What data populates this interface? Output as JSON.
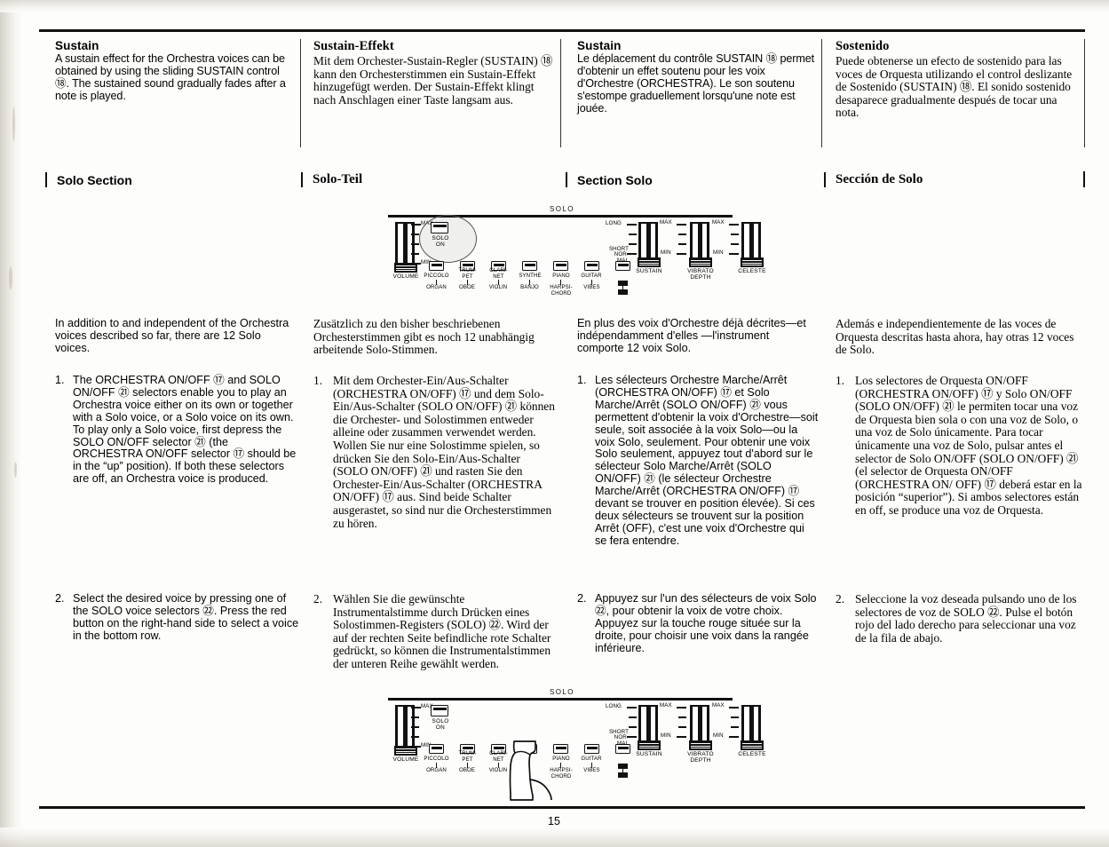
{
  "page": {
    "number": "15"
  },
  "sections": {
    "sustain": [
      {
        "lang": "en",
        "title": "Sustain",
        "body": "A sustain effect for the Orchestra voices can be obtained by using the sliding SUSTAIN control ⑱. The sustained sound gradually fades after a note is played."
      },
      {
        "lang": "de",
        "title": "Sustain-Effekt",
        "body": "Mit dem Orchester-Sustain-Regler (SUSTAIN) ⑱ kann den Orchesterstimmen ein Sustain-Effekt hinzugefügt werden. Der Sustain-Effekt klingt nach Anschlagen einer Taste langsam aus."
      },
      {
        "lang": "fr",
        "title": "Sustain",
        "body": "Le déplacement du contrôle SUSTAIN ⑱ permet d'obtenir un effet soutenu pour les voix d'Orchestre (ORCHESTRA). Le son soutenu s'estompe graduellement lorsqu'une note est jouée."
      },
      {
        "lang": "es",
        "title": "Sostenido",
        "body": "Puede obtenerse un efecto de sostenido para las voces de Orquesta utilizando el control deslizante de Sostenido (SUSTAIN) ⑱. El sonido sostenido desaparece gradualmente después de tocar una nota."
      }
    ],
    "solo_headers": [
      {
        "lang": "en",
        "label": "Solo Section"
      },
      {
        "lang": "de",
        "label": "Solo-Teil"
      },
      {
        "lang": "fr",
        "label": "Section Solo"
      },
      {
        "lang": "es",
        "label": "Sección de Solo"
      }
    ],
    "solo_intro": [
      {
        "lang": "en",
        "text": "In addition to and independent of the Orchestra voices described so far, there are 12 Solo voices."
      },
      {
        "lang": "de",
        "text": "Zusätzlich zu den bisher beschriebenen Orchesterstimmen gibt es noch 12 unabhängig arbeitende Solo-Stimmen."
      },
      {
        "lang": "fr",
        "text": "En plus des voix d'Orchestre déjà décrites—et indépendamment d'elles —l'instrument comporte 12 voix Solo."
      },
      {
        "lang": "es",
        "text": "Además e independientemente de las voces de Orquesta descritas hasta ahora, hay otras 12 voces de Solo."
      }
    ],
    "solo_items": [
      {
        "lang": "en",
        "items": [
          {
            "num": "1.",
            "text": "The ORCHESTRA ON/OFF ⑰ and SOLO ON/OFF ㉑ selectors enable you to play an Orchestra voice either on its own or together with a Solo voice, or a Solo voice on its own. To play only a Solo voice, first depress the SOLO ON/OFF selector ㉑ (the ORCHESTRA ON/OFF selector ⑰ should be in the “up” position). If both these selectors are off, an Orchestra voice is produced."
          },
          {
            "num": "2.",
            "text": "Select the desired voice by pressing one of the SOLO voice selectors ㉒. Press the red button on the right-hand side to select a voice in the bottom row."
          }
        ]
      },
      {
        "lang": "de",
        "items": [
          {
            "num": "1.",
            "text": "Mit dem Orchester-Ein/Aus-Schalter (ORCHESTRA ON/OFF) ⑰ und dem Solo-Ein/Aus-Schalter (SOLO ON/OFF) ㉑ können die Orchester- und Solostimmen entweder alleine oder zusammen verwendet werden. Wollen Sie nur eine Solostimme spielen, so drücken Sie den Solo-Ein/Aus-Schalter (SOLO ON/OFF) ㉑ und rasten Sie den Orchester-Ein/Aus-Schalter (ORCHESTRA ON/OFF) ⑰ aus. Sind beide Schalter ausgerastet, so sind nur die Orchesterstimmen zu hören."
          },
          {
            "num": "2.",
            "text": "Wählen Sie die gewünschte Instrumentalstimme durch Drücken eines Solostimmen-Registers (SOLO) ㉒. Wird der auf der rechten Seite befindliche rote Schalter gedrückt, so können die Instrumentalstimmen der unteren Reihe gewählt werden."
          }
        ]
      },
      {
        "lang": "fr",
        "items": [
          {
            "num": "1.",
            "text": "Les sélecteurs Orchestre Marche/Arrêt (ORCHESTRA ON/OFF) ⑰ et Solo Marche/Arrêt (SOLO ON/OFF) ㉑ vous permettent d'obtenir la voix d'Orchestre—soit seule, soit associée à la voix Solo—ou la voix Solo, seulement. Pour obtenir une voix Solo seulement, appuyez tout d'abord sur le sélecteur Solo Marche/Arrêt (SOLO ON/OFF) ㉑ (le sélecteur Orchestre Marche/Arrêt (ORCHESTRA ON/OFF) ⑰ devant se trouver en position élevée). Si ces deux sélecteurs se trouvent sur la position Arrêt (OFF), c'est une voix d'Orchestre qui se fera entendre."
          },
          {
            "num": "2.",
            "text": "Appuyez sur l'un des sélecteurs de voix Solo ㉒, pour obtenir la voix de votre choix. Appuyez sur la touche rouge située sur la droite, pour choisir une voix dans la rangée inférieure."
          }
        ]
      },
      {
        "lang": "es",
        "items": [
          {
            "num": "1.",
            "text": "Los selectores de Orquesta ON/OFF (ORCHESTRA ON/OFF) ⑰ y Solo ON/OFF (SOLO ON/OFF) ㉑ le permiten tocar una voz de Orquesta bien sola o con una voz de Solo, o una voz de Solo únicamente. Para tocar únicamente una voz de Solo, pulsar antes el selector de Solo ON/OFF (SOLO ON/OFF) ㉑ (el selector de Orquesta ON/OFF (ORCHESTRA ON/ OFF) ⑰ deberá estar en la posición “superior”). Si ambos selectores están en off, se produce una voz de Orquesta."
          },
          {
            "num": "2.",
            "text": "Seleccione la voz deseada pulsando uno de los selectores de voz de SOLO ㉒. Pulse el botón rojo del lado derecho para seleccionar una voz de la fila de abajo."
          }
        ]
      }
    ]
  },
  "panel": {
    "solo_banner": "SOLO",
    "volume_label": "VOLUME",
    "volume_ticks": {
      "max": "MAX",
      "min": "MIN"
    },
    "solo_on": {
      "line1": "SOLO",
      "line2": "ON"
    },
    "voices": [
      {
        "top": "PICCOLO",
        "bottom": "ORGAN"
      },
      {
        "top": "TRUM-\nPET",
        "bottom": "OBOE"
      },
      {
        "top": "CLARI-\nNET",
        "bottom": "VIOLIN"
      },
      {
        "top": "SYNTHE",
        "bottom": "BANJO"
      },
      {
        "top": "PIANO",
        "bottom": "HARPSI-\nCHORD"
      },
      {
        "top": "GUITAR",
        "bottom": "VIBES"
      }
    ],
    "sustain": {
      "label": "SUSTAIN",
      "top": "LONG",
      "bottom": "SHORT\nNOR-\nMAL"
    },
    "vibrato": {
      "label": "VIBRATO\nDEPTH",
      "top": "MAX",
      "bottom": "MIN"
    },
    "celeste": {
      "label": "CELESTE",
      "top": "MAX",
      "bottom": "MIN"
    }
  }
}
